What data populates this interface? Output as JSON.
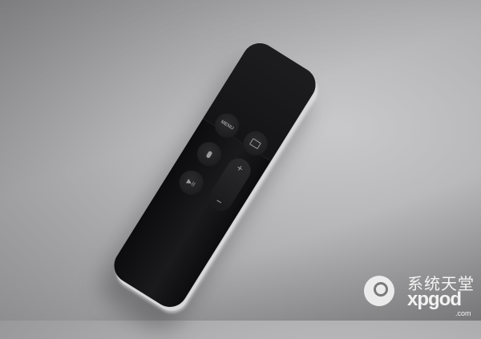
{
  "photo": {
    "subject": "media-remote",
    "buttons": {
      "menu_label": "MENU",
      "tv_icon": "tv-icon",
      "mic_icon": "microphone-icon",
      "play_pause_label": "▶II",
      "volume_up_label": "+",
      "volume_down_label": "−"
    }
  },
  "watermark": {
    "chinese_text": "系统天堂",
    "brand": "xpgod",
    "domain": ".com"
  }
}
